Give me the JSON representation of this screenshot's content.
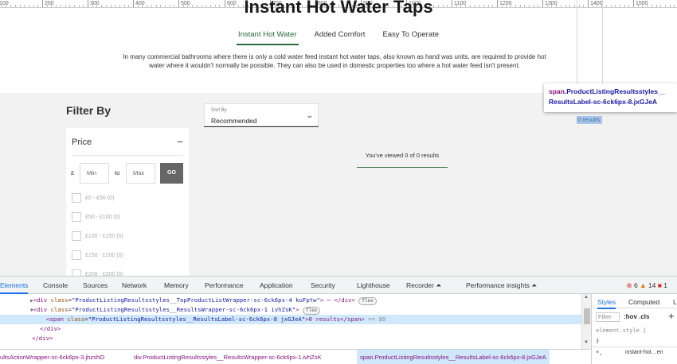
{
  "ruler": {
    "labels": [
      "100",
      "200",
      "300",
      "400",
      "500",
      "600",
      "700",
      "800",
      "900",
      "1000",
      "1100",
      "1200",
      "1300",
      "1400",
      "1500"
    ]
  },
  "page": {
    "title": "Instant Hot Water Taps",
    "tabs": [
      {
        "label": "Instant Hot Water",
        "active": true
      },
      {
        "label": "Added Comfort",
        "active": false
      },
      {
        "label": "Easy To Operate",
        "active": false
      }
    ],
    "intro": "In many commercial bathrooms where there is only a cold water feed instant hot water taps, also known as hand was units, are required to provide hot water where it wouldn't normally be possible. They can also be used in domestic properties too where a hot water feed isn't present.",
    "filter_title": "Filter By",
    "sort": {
      "label": "Sort By",
      "value": "Recommended"
    },
    "results_label": "0 results",
    "viewed_text": "You've viewed 0 of 0 results",
    "price_panel": {
      "title": "Price",
      "collapse_symbol": "−",
      "currency": "£",
      "min_placeholder": "Min",
      "to_label": "to",
      "max_placeholder": "Max",
      "go_label": "GO",
      "options": [
        "£0 - £50 (0)",
        "£50 - £100 (0)",
        "£100 - £150 (0)",
        "£150 - £200 (0)",
        "£200 - £300 (0)"
      ]
    }
  },
  "tooltip": {
    "tag": "span",
    "class_line1": ".ProductListingResultsstyles__",
    "class_line2": "ResultsLabel-sc-6ck6px-8.jxGJeA"
  },
  "devtools": {
    "tabs": [
      "Elements",
      "Console",
      "Sources",
      "Network",
      "Memory",
      "Performance",
      "Application",
      "Security",
      "Lighthouse",
      "Recorder ⏶",
      "Performance insights ⏶"
    ],
    "active_tab": "Elements",
    "errors": "6",
    "warnings": "14",
    "issues": "1",
    "code_lines": [
      {
        "indent": "▶",
        "open": "<div",
        "attr": "class",
        "val": "\"ProductListingResultsstyles__TopProductListWrapper-sc-6ck6px-4 kuFptw\"",
        "rest": "> ⋯ </div>",
        "badge": "flex"
      },
      {
        "indent": "▼",
        "open": "<div",
        "attr": "class",
        "val": "\"ProductListingResultsstyles__ResultsWrapper-sc-6ck6px-1 ivhZsK\"",
        "rest": ">",
        "badge": "flex"
      },
      {
        "indent": "",
        "open": "<span",
        "attr": "class",
        "val": "\"ProductListingResultsstyles__ResultsLabel-sc-6ck6px-8 jxGJeA\"",
        "rest": ">0 results</span>",
        "suffix": " == $0"
      },
      {
        "indent": "",
        "close": "</div>"
      },
      {
        "indent": "",
        "close": "</div>"
      }
    ],
    "styles": {
      "tabs": [
        "Styles",
        "Computed",
        "L"
      ],
      "filter_placeholder": "Filter",
      "hov": ":hov .cls",
      "plus": "+",
      "element_style": "element.style {",
      "close_brace": "}",
      "star": "*,",
      "star_source": "instant-hot…en"
    },
    "breadcrumbs": [
      "ultsActionWrapper-sc-6ck6px-3.jhzshO",
      "div.ProductListingResultsstyles__ResultsWrapper-sc-6ck6px-1.ivhZsK",
      "span.ProductListingResultsstyles__ResultsLabel-sc-6ck6px-8.jxGJeA"
    ]
  }
}
